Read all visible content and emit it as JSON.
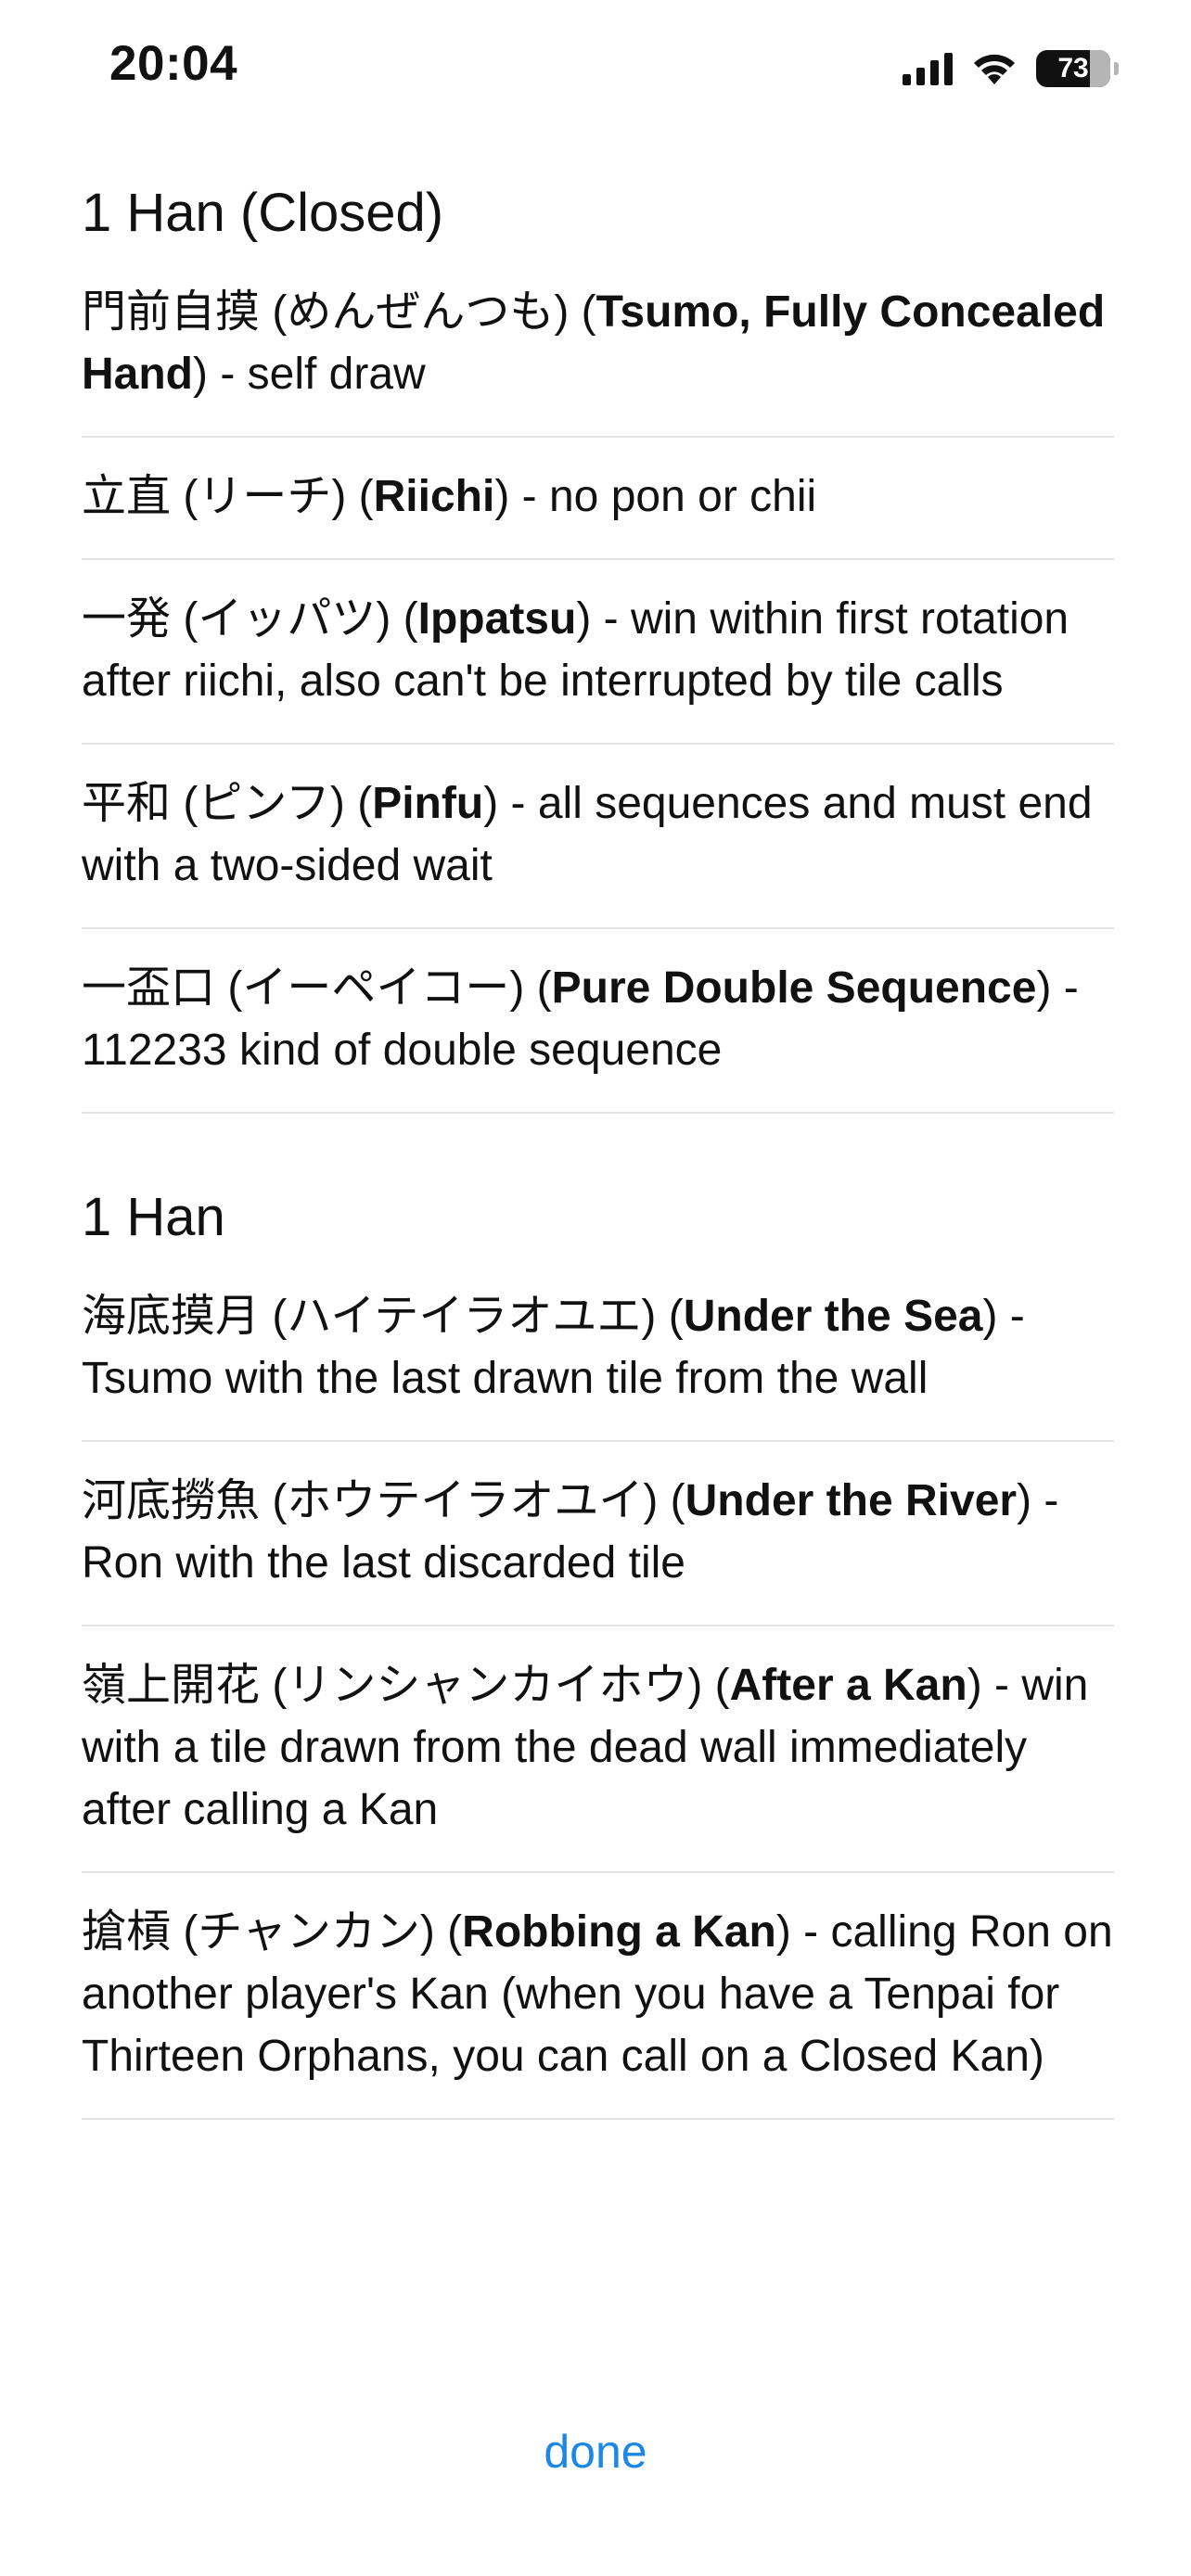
{
  "status_bar": {
    "time": "20:04",
    "battery": "73",
    "battery_fraction": 0.73
  },
  "sections": [
    {
      "title": "1 Han (Closed)",
      "items": [
        {
          "jp": "門前自摸 (めんぜんつも)",
          "name": "Tsumo, Fully Concealed Hand",
          "desc": " - self draw"
        },
        {
          "jp": "立直 (リーチ)",
          "name": "Riichi",
          "desc": " - no pon or chii"
        },
        {
          "jp": "一発 (イッパツ)",
          "name": "Ippatsu",
          "desc": " - win within first rotation after riichi, also can't be interrupted by tile calls"
        },
        {
          "jp": "平和 (ピンフ)",
          "name": "Pinfu",
          "desc": " - all sequences and must end with a two-sided wait"
        },
        {
          "jp": "一盃口 (イーペイコー)",
          "name": "Pure Double Sequence",
          "desc": " - 112233 kind of double sequence"
        }
      ]
    },
    {
      "title": "1 Han",
      "items": [
        {
          "jp": "海底摸月 (ハイテイラオユエ)",
          "name": "Under the Sea",
          "desc": " - Tsumo with the last drawn tile from the wall"
        },
        {
          "jp": "河底撈魚 (ホウテイラオユイ)",
          "name": "Under the River",
          "desc": " - Ron with the last discarded tile"
        },
        {
          "jp": "嶺上開花 (リンシャンカイホウ)",
          "name": "After a Kan",
          "desc": " - win with a tile drawn from the dead wall immediately after calling a Kan"
        },
        {
          "jp": "搶槓 (チャンカン)",
          "name": "Robbing a Kan",
          "desc": " - calling Ron on another player's Kan (when you have a Tenpai for Thirteen Orphans, you can call on a Closed Kan)"
        }
      ]
    }
  ],
  "done_label": "done",
  "colors": {
    "accent": "#1b87e6",
    "divider": "#e3e3e6",
    "text": "#111111"
  }
}
